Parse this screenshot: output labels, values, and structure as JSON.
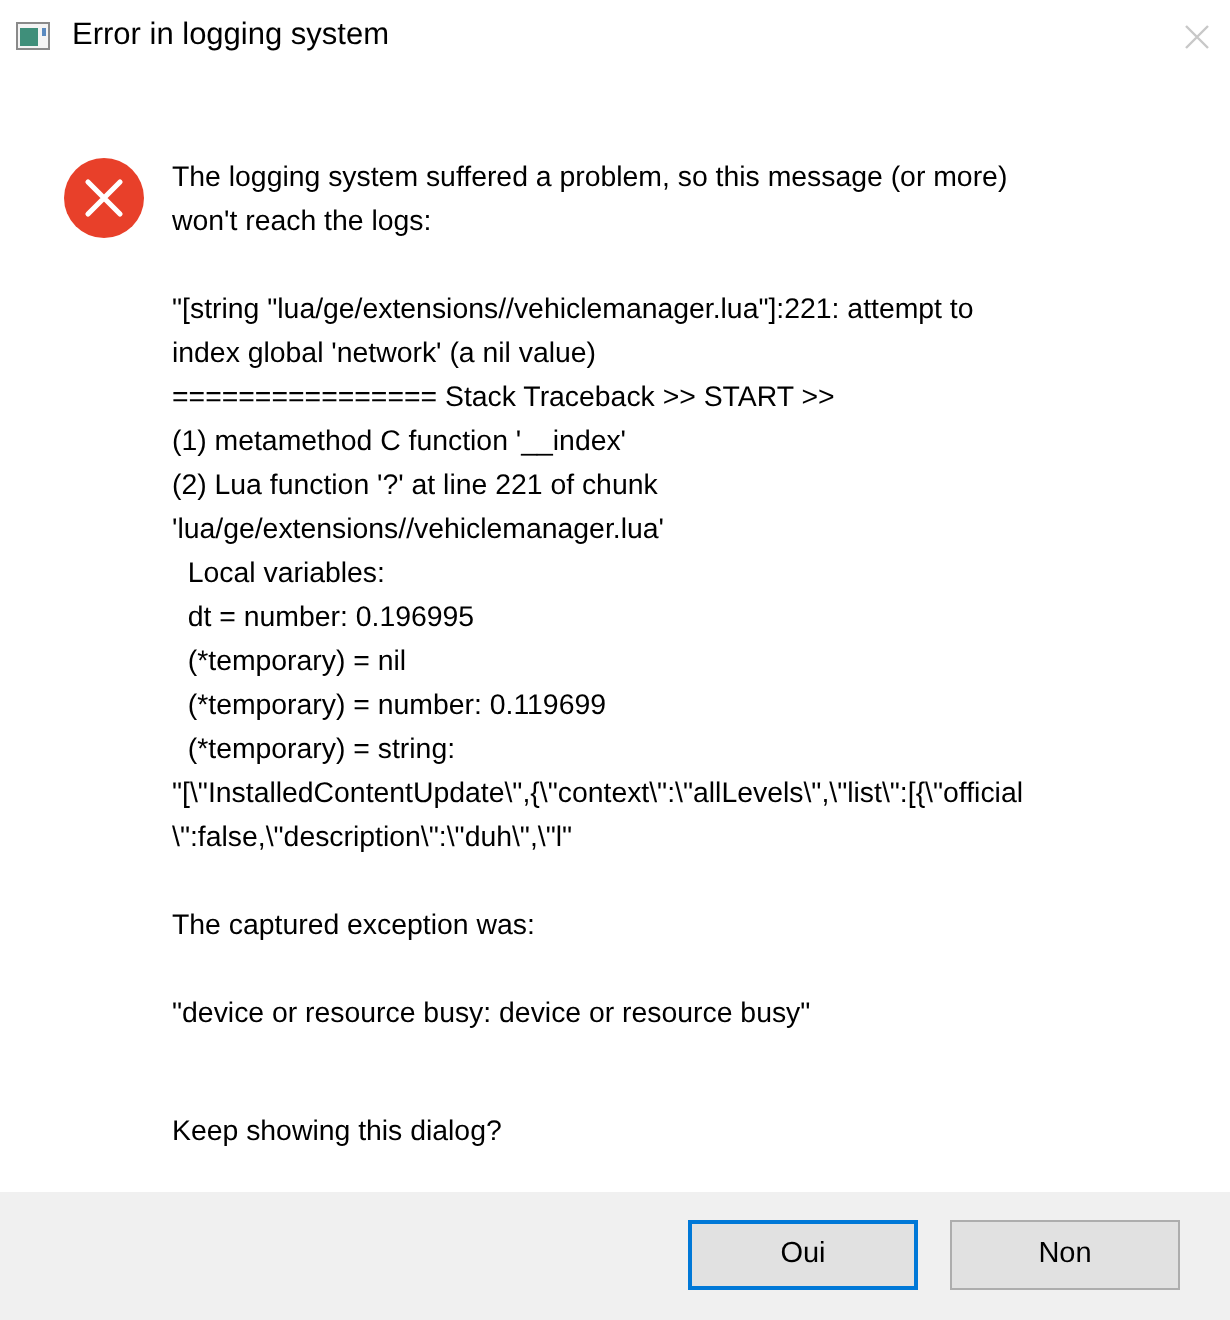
{
  "window": {
    "title": "Error in logging system",
    "close_disabled": true
  },
  "message": [
    "The logging system suffered a problem, so this message (or more)\nwon't reach the logs:",
    "\"[string \"lua/ge/extensions//vehiclemanager.lua\"]:221: attempt to\nindex global 'network' (a nil value)\n================ Stack Traceback >> START >>\n(1) metamethod C function '__index'\n(2) Lua function '?' at line 221 of chunk\n'lua/ge/extensions//vehiclemanager.lua'\n  Local variables:\n  dt = number: 0.196995\n  (*temporary) = nil\n  (*temporary) = number: 0.119699\n  (*temporary) = string:\n\"[\\\"InstalledContentUpdate\\\",{\\\"context\\\":\\\"allLevels\\\",\\\"list\\\":[{\\\"official\n\\\":false,\\\"description\\\":\\\"duh\\\",\\\"l\"",
    "The captured exception was:",
    "\"device or resource busy: device or resource busy\""
  ],
  "question": "Keep showing this dialog?",
  "buttons": [
    {
      "label": "Oui",
      "default": true
    },
    {
      "label": "Non",
      "default": false
    }
  ]
}
